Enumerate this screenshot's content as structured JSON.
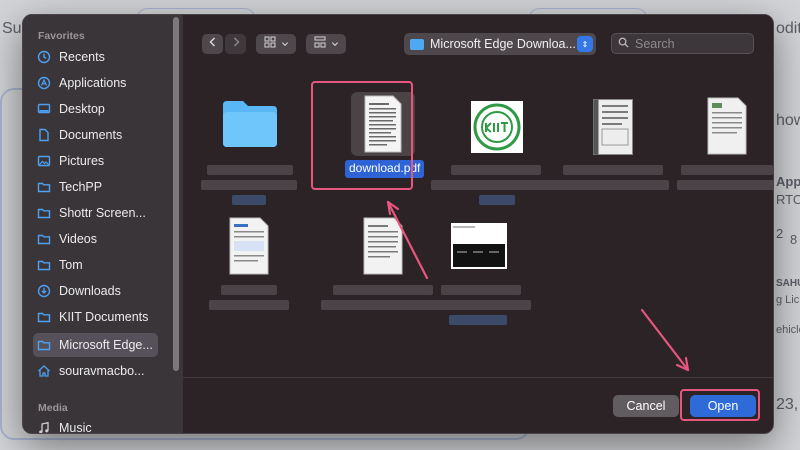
{
  "background": {
    "left_text": "Su",
    "right_texts": [
      "odit",
      "how",
      "Apps",
      "RTO,",
      "2",
      "8",
      "SAHU",
      "g Lic",
      "ehicle",
      "23,"
    ]
  },
  "dialog": {
    "sidebar": {
      "favorites_heading": "Favorites",
      "items": [
        {
          "label": "Recents",
          "icon": "clock-icon"
        },
        {
          "label": "Applications",
          "icon": "applications-icon"
        },
        {
          "label": "Desktop",
          "icon": "desktop-icon"
        },
        {
          "label": "Documents",
          "icon": "document-icon"
        },
        {
          "label": "Pictures",
          "icon": "pictures-icon"
        },
        {
          "label": "TechPP",
          "icon": "folder-icon"
        },
        {
          "label": "Shottr Screen...",
          "icon": "folder-icon"
        },
        {
          "label": "Videos",
          "icon": "folder-icon"
        },
        {
          "label": "Tom",
          "icon": "folder-icon"
        },
        {
          "label": "Downloads",
          "icon": "download-icon"
        },
        {
          "label": "KIIT Documents",
          "icon": "folder-icon"
        },
        {
          "label": "Microsoft Edge...",
          "icon": "folder-icon",
          "selected": true
        },
        {
          "label": "souravmacbo...",
          "icon": "home-icon"
        }
      ],
      "media_heading": "Media",
      "media_items": [
        {
          "label": "Music",
          "icon": "music-icon"
        }
      ]
    },
    "toolbar": {
      "back_icon": "chevron-left-icon",
      "forward_icon": "chevron-right-icon",
      "view_icon": "grid-icon",
      "group_icon": "group-icon",
      "location": "Microsoft Edge Downloa...",
      "search_placeholder": "Search"
    },
    "files": [
      {
        "name": "",
        "kind": "folder"
      },
      {
        "name": "download.pdf",
        "kind": "pdf",
        "selected": true
      },
      {
        "name": "",
        "kind": "logo-image"
      },
      {
        "name": "",
        "kind": "document"
      },
      {
        "name": "",
        "kind": "document"
      },
      {
        "name": "",
        "kind": "document"
      },
      {
        "name": "",
        "kind": "document"
      },
      {
        "name": "",
        "kind": "screenshot"
      }
    ],
    "buttons": {
      "cancel": "Cancel",
      "open": "Open"
    },
    "colors": {
      "accent": "#2e6bd8",
      "annotation": "#e8557f"
    }
  }
}
